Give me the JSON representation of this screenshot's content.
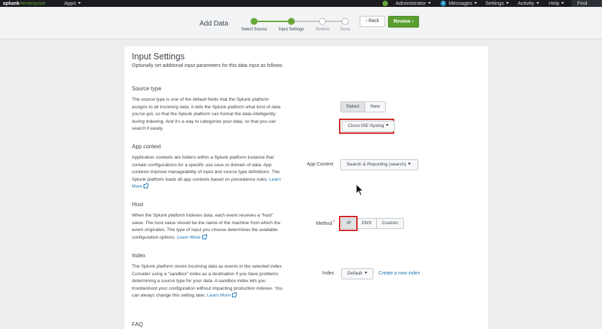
{
  "topbar": {
    "logo_main": "splunk",
    "logo_gt": ">",
    "logo_sub": "enterprise",
    "apps": "Apps",
    "administrator": "Administrator",
    "messages_badge": "1",
    "messages": "Messages",
    "settings": "Settings",
    "activity": "Activity",
    "help": "Help",
    "find": "Find"
  },
  "header": {
    "title": "Add Data",
    "steps": [
      {
        "label": "Select Source",
        "state": "done"
      },
      {
        "label": "Input Settings",
        "state": "done"
      },
      {
        "label": "Review",
        "state": "todo"
      },
      {
        "label": "Done",
        "state": "todo"
      }
    ],
    "back_label": "Back",
    "back_glyph": "‹",
    "review_label": "Review",
    "review_glyph": "›"
  },
  "panel": {
    "title": "Input Settings",
    "subtitle": "Optionally set additional input parameters for this data input as follows:",
    "source_type": {
      "title": "Source type",
      "desc": "The source type is one of the default fields that the Splunk platform assigns to all incoming data. It tells the Splunk platform what kind of data you've got, so that the Splunk platform can format the data intelligently during indexing. And it's a way to categorize your data, so that you can search it easily.",
      "select_label": "Select",
      "new_label": "New",
      "value": "Cisco:ISE:Syslog"
    },
    "app_context": {
      "title": "App context",
      "desc": "Application contexts are folders within a Splunk platform instance that contain configurations for a specific use case or domain of data. App contexts improve manageability of input and source type definitions. The Splunk platform loads all app contexts based on precedence rules.",
      "learn_more": "Learn More",
      "field_label": "App Context",
      "value": "Search & Reporting (search)"
    },
    "host": {
      "title": "Host",
      "desc": "When the Splunk platform indexes data, each event receives a \"host\" value. The host value should be the name of the machine from which the event originates. The type of input you choose determines the available configuration options.",
      "learn_more": "Learn More",
      "field_label": "Method",
      "help_mark": "?",
      "options": [
        "IP",
        "DNS",
        "Custom"
      ]
    },
    "index": {
      "title": "Index",
      "desc": "The Splunk platform stores incoming data as events in the selected index. Consider using a \"sandbox\" index as a destination if you have problems determining a source type for your data. A sandbox index lets you troubleshoot your configuration without impacting production indexes. You can always change this setting later.",
      "learn_more": "Learn More",
      "field_label": "Index",
      "value": "Default",
      "create_link": "Create a new index"
    },
    "faq": {
      "title": "FAQ"
    }
  },
  "colors": {
    "accent_green": "#65a637",
    "highlight_red": "#d02020",
    "link_blue": "#1e75b3"
  }
}
